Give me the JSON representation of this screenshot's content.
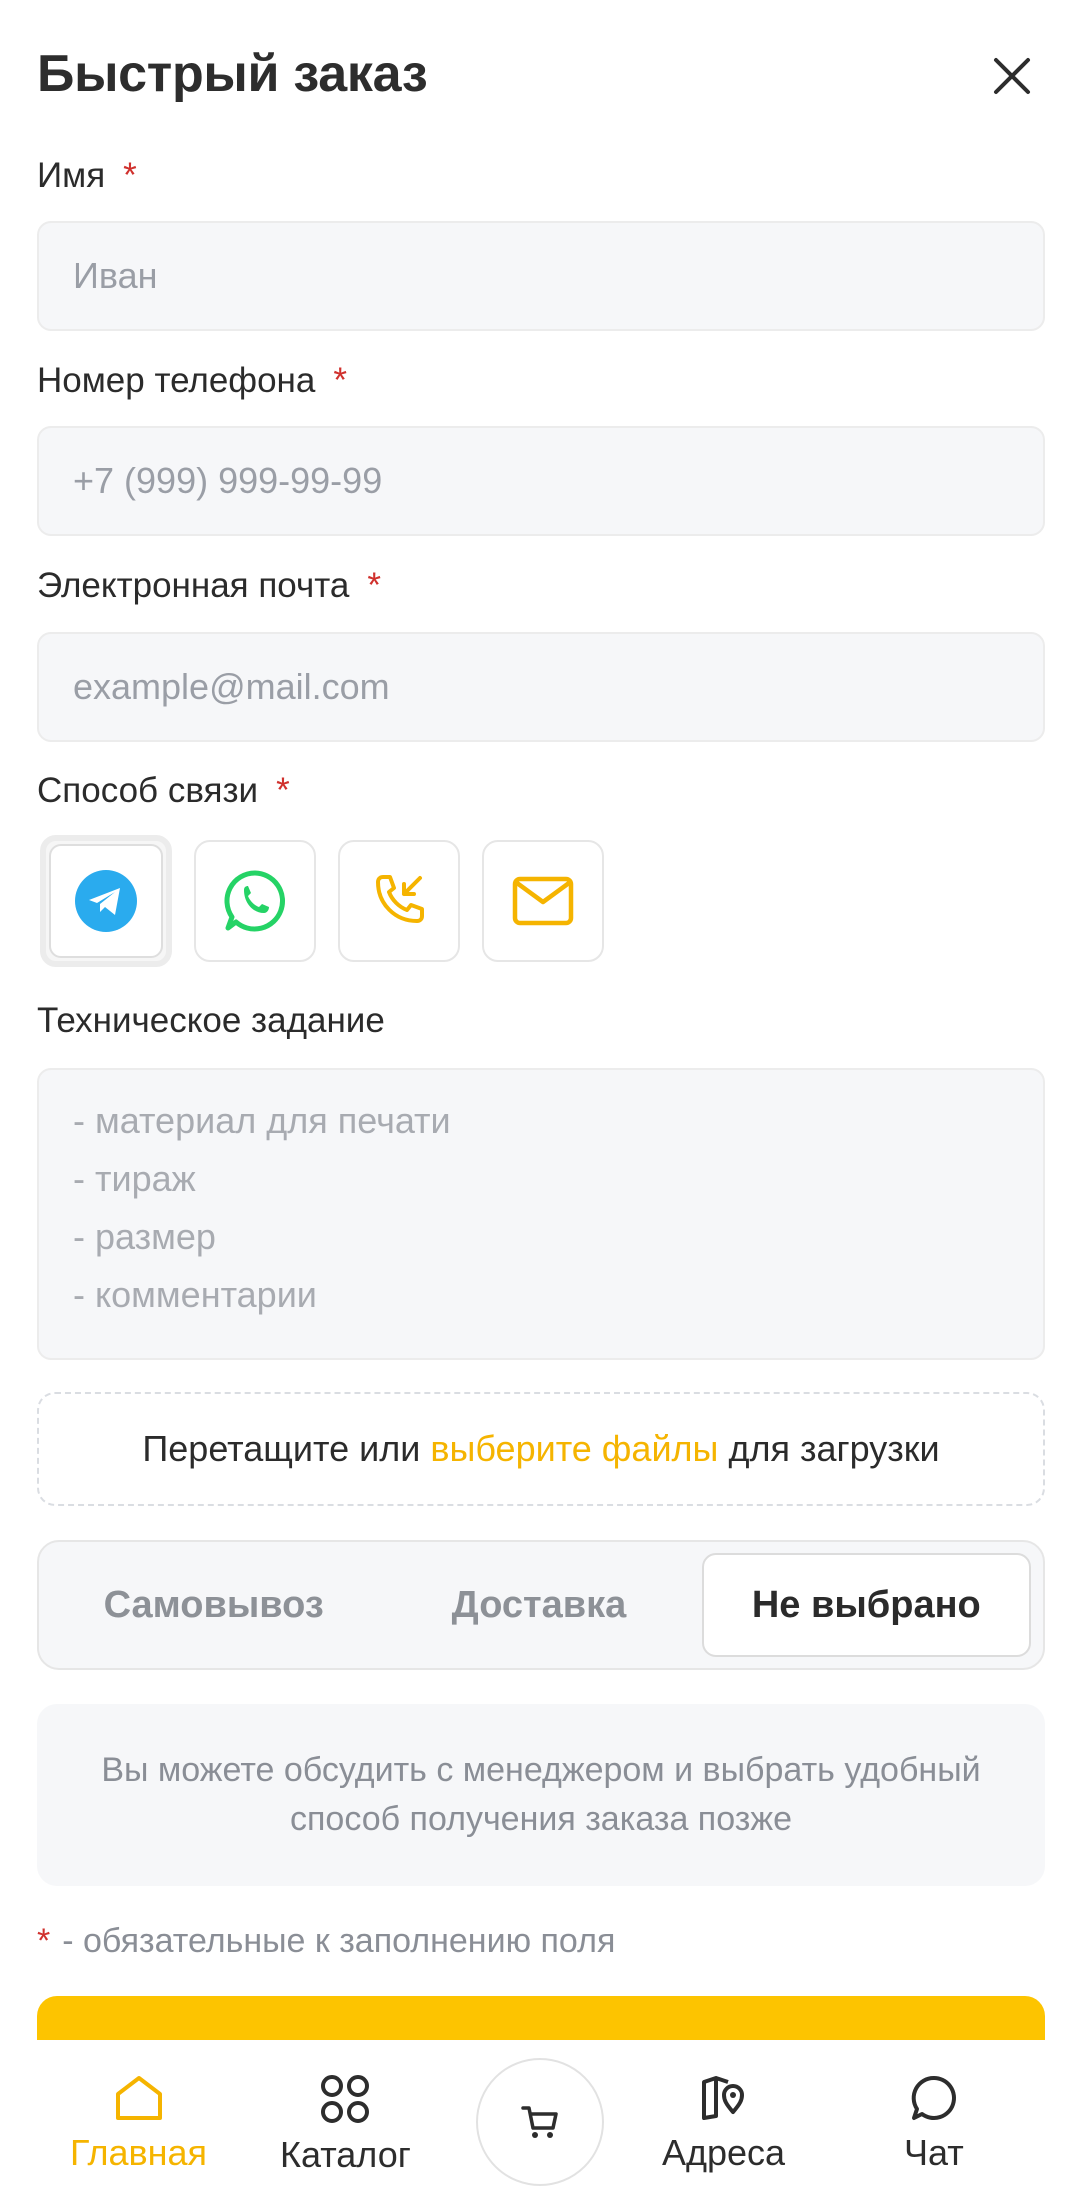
{
  "header": {
    "title": "Быстрый заказ"
  },
  "form": {
    "name": {
      "label": "Имя",
      "required_mark": "*",
      "placeholder": "Иван"
    },
    "phone": {
      "label": "Номер телефона",
      "required_mark": "*",
      "placeholder": "+7 (999) 999-99-99"
    },
    "email": {
      "label": "Электронная почта",
      "required_mark": "*",
      "placeholder": "example@mail.com"
    },
    "contact_method": {
      "label": "Способ связи",
      "required_mark": "*",
      "options": [
        "telegram-icon",
        "whatsapp-icon",
        "phone-call-icon",
        "mail-icon"
      ],
      "selected": "telegram-icon"
    },
    "spec": {
      "label": "Техническое задание",
      "placeholder_lines": [
        "- материал для печати",
        "- тираж",
        "- размер",
        "- комментарии"
      ]
    },
    "upload": {
      "before": "Перетащите или",
      "link": "выберите файлы",
      "after": "для загрузки"
    },
    "delivery": {
      "options": [
        "Самовывоз",
        "Доставка",
        "Не выбрано"
      ],
      "selected": "Не выбрано"
    },
    "info_text": "Вы можете обсудить с менеджером и выбрать удобный способ получения заказа позже",
    "required_note": {
      "star": "*",
      "text": "- обязательные к заполнению поля"
    }
  },
  "tabbar": {
    "items": [
      {
        "label": "Главная",
        "icon": "home-icon",
        "active": true
      },
      {
        "label": "Каталог",
        "icon": "catalog-icon",
        "active": false
      },
      {
        "label": "",
        "icon": "cart-icon",
        "active": false
      },
      {
        "label": "Адреса",
        "icon": "map-icon",
        "active": false
      },
      {
        "label": "Чат",
        "icon": "chat-icon",
        "active": false
      }
    ]
  },
  "colors": {
    "accent": "#fdc400",
    "link": "#f5b400",
    "required": "#d0312d",
    "telegram": "#2aabee",
    "whatsapp": "#25d366"
  }
}
